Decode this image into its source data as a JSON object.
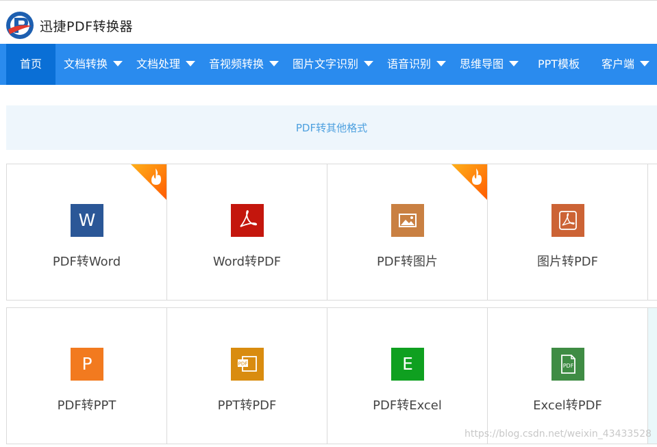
{
  "header": {
    "brand": "迅捷PDF转换器"
  },
  "nav": {
    "items": [
      {
        "label": "首页"
      },
      {
        "label": "文档转换"
      },
      {
        "label": "文档处理"
      },
      {
        "label": "音视频转换"
      },
      {
        "label": "图片文字识别"
      },
      {
        "label": "语音识别"
      },
      {
        "label": "思维导图"
      },
      {
        "label": "PPT模板"
      },
      {
        "label": "客户端"
      }
    ]
  },
  "section": {
    "title": "PDF转其他格式"
  },
  "tools": [
    {
      "label": "PDF转Word",
      "icon": "word-icon",
      "color": "#2b5797",
      "glyph": "W",
      "hot": true
    },
    {
      "label": "Word转PDF",
      "icon": "pdf-acrobat-icon",
      "color": "#c4160d",
      "glyph": "",
      "hot": false
    },
    {
      "label": "PDF转图片",
      "icon": "image-icon",
      "color": "#c98042",
      "glyph": "",
      "hot": true
    },
    {
      "label": "图片转PDF",
      "icon": "pdf-acrobat-icon",
      "color": "#cc6335",
      "glyph": "",
      "hot": false
    },
    {
      "label": "PDF转PPT",
      "icon": "powerpoint-icon",
      "color": "#f27a1f",
      "glyph": "P",
      "hot": false
    },
    {
      "label": "PPT转PDF",
      "icon": "ppt-to-pdf-icon",
      "color": "#d98c0f",
      "glyph": "",
      "hot": false
    },
    {
      "label": "PDF转Excel",
      "icon": "excel-icon",
      "color": "#0fa020",
      "glyph": "E",
      "hot": false
    },
    {
      "label": "Excel转PDF",
      "icon": "pdf-document-icon",
      "color": "#3f8c44",
      "glyph": "",
      "hot": false
    }
  ],
  "watermark": "https://blog.csdn.net/weixin_43433528"
}
